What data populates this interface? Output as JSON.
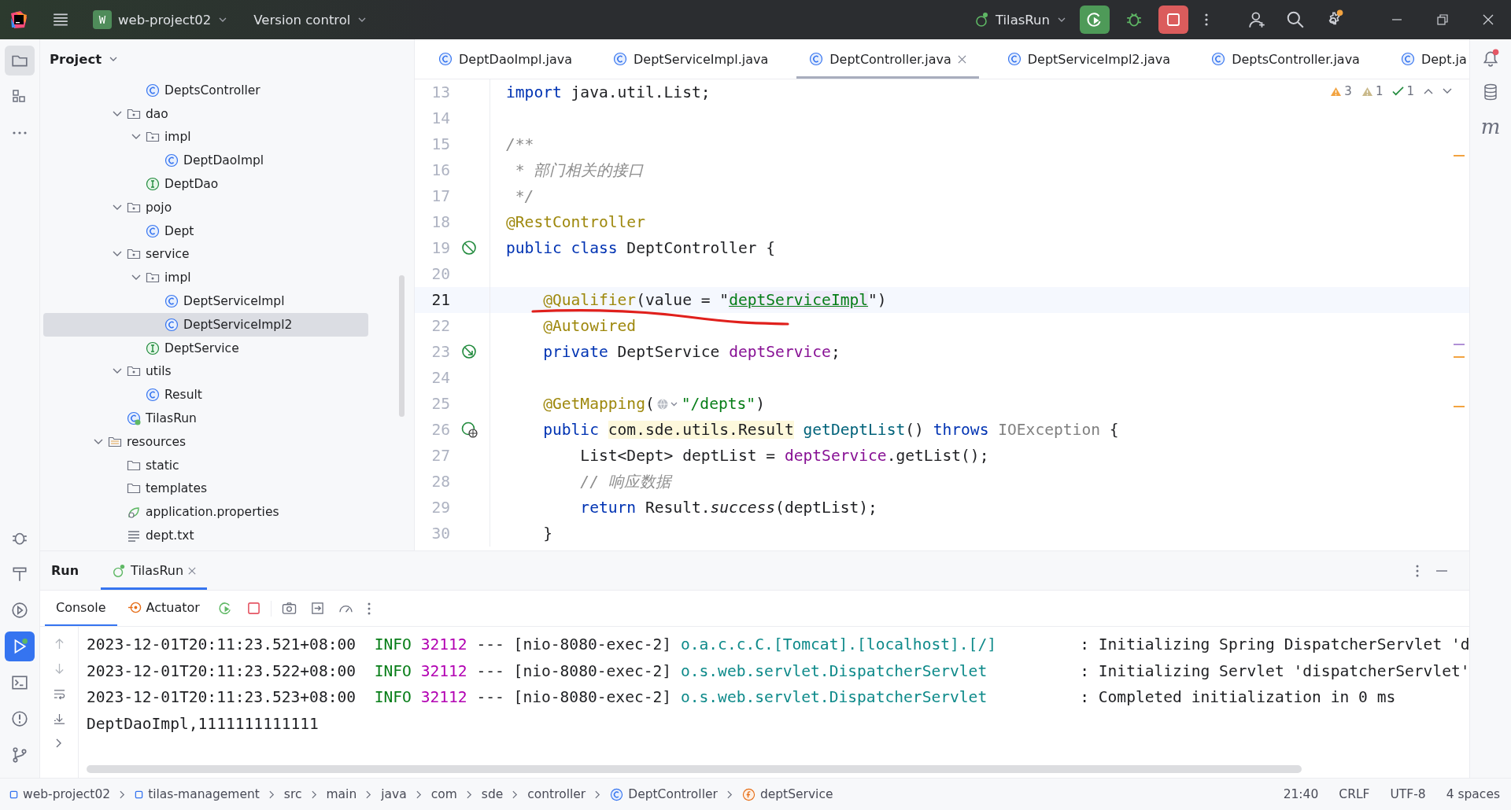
{
  "title_bar": {
    "project_badge": "W",
    "project": "web-project02",
    "vcs": "Version control",
    "run_config": "TilasRun"
  },
  "left_toolbar": {
    "top": [
      {
        "kind": "folder",
        "selected": true
      },
      {
        "kind": "structure",
        "selected": false
      },
      {
        "kind": "more",
        "selected": false
      }
    ],
    "bottom": [
      {
        "kind": "debug",
        "selected": false
      },
      {
        "kind": "build",
        "selected": false
      },
      {
        "kind": "services",
        "selected": false
      },
      {
        "kind": "run",
        "selected": true
      },
      {
        "kind": "terminal",
        "selected": false
      },
      {
        "kind": "problems",
        "selected": false
      },
      {
        "kind": "git",
        "selected": false
      }
    ]
  },
  "right_toolbar": {
    "maven_label": "m"
  },
  "project": {
    "title": "Project",
    "tree": [
      {
        "kind": "cut",
        "children": [
          {
            "kind": "cut",
            "children": [
              {
                "label": "DeptsController",
                "kind": "class",
                "selected": false
              }
            ]
          },
          {
            "label": "dao",
            "kind": "package",
            "expanded": true,
            "selected": false,
            "children": [
              {
                "label": "impl",
                "kind": "package",
                "expanded": true,
                "selected": false,
                "children": [
                  {
                    "label": "DeptDaoImpl",
                    "kind": "class",
                    "selected": false
                  }
                ]
              },
              {
                "label": "DeptDao",
                "kind": "interface",
                "selected": false
              }
            ]
          },
          {
            "label": "pojo",
            "kind": "package",
            "expanded": true,
            "selected": false,
            "children": [
              {
                "label": "Dept",
                "kind": "class",
                "selected": false
              }
            ]
          },
          {
            "label": "service",
            "kind": "package",
            "expanded": true,
            "selected": false,
            "children": [
              {
                "label": "impl",
                "kind": "package",
                "expanded": true,
                "selected": false,
                "children": [
                  {
                    "label": "DeptServiceImpl",
                    "kind": "class",
                    "selected": false
                  },
                  {
                    "label": "DeptServiceImpl2",
                    "kind": "class",
                    "selected": true
                  }
                ]
              },
              {
                "label": "DeptService",
                "kind": "interface",
                "selected": false
              }
            ]
          },
          {
            "label": "utils",
            "kind": "package",
            "expanded": true,
            "selected": false,
            "children": [
              {
                "label": "Result",
                "kind": "class",
                "selected": false
              }
            ]
          },
          {
            "label": "TilasRun",
            "kind": "app",
            "selected": false
          }
        ]
      },
      {
        "label": "resources",
        "kind": "resources",
        "expanded": true,
        "selected": false,
        "children": [
          {
            "label": "static",
            "kind": "folder",
            "selected": false
          },
          {
            "label": "templates",
            "kind": "folder",
            "selected": false
          },
          {
            "label": "application.properties",
            "kind": "properties",
            "selected": false
          },
          {
            "label": "dept.txt",
            "kind": "text",
            "selected": false
          }
        ]
      }
    ]
  },
  "editor": {
    "tabs": [
      {
        "label": "DeptDaoImpl.java",
        "selected": false
      },
      {
        "label": "DeptServiceImpl.java",
        "selected": false
      },
      {
        "label": "DeptController.java",
        "selected": true
      },
      {
        "label": "DeptServiceImpl2.java",
        "selected": false
      },
      {
        "label": "DeptsController.java",
        "selected": false
      },
      {
        "label": "Dept.ja",
        "selected": false
      }
    ],
    "inspections": {
      "warnings": "3",
      "weak_warnings": "1",
      "passed": "1"
    },
    "lines": [
      {
        "n": "13",
        "current": false,
        "tokens": [
          {
            "kind": "keyword",
            "text": "import "
          },
          {
            "kind": "plain",
            "text": "java.util.List;"
          }
        ]
      },
      {
        "n": "14",
        "current": false
      },
      {
        "n": "15",
        "current": false,
        "tokens": [
          {
            "kind": "comment",
            "text": "/**"
          }
        ]
      },
      {
        "n": "16",
        "current": false,
        "tokens": [
          {
            "kind": "comment",
            "text": " * 部门相关的接口"
          }
        ]
      },
      {
        "n": "17",
        "current": false,
        "tokens": [
          {
            "kind": "comment",
            "text": " */"
          }
        ]
      },
      {
        "n": "18",
        "current": false,
        "tokens": [
          {
            "kind": "annotation",
            "text": "@RestController"
          }
        ]
      },
      {
        "n": "19",
        "current": false,
        "gutter_icon": {
          "kind": "bean"
        },
        "tokens": [
          {
            "kind": "keyword",
            "text": "public class "
          },
          {
            "kind": "plain",
            "text": "DeptController {"
          }
        ]
      },
      {
        "n": "20",
        "current": false
      },
      {
        "n": "21",
        "current": true,
        "tokens": [
          {
            "kind": "annotation",
            "text": "    @Qualifier"
          },
          {
            "kind": "plain",
            "text": "(value = \""
          },
          {
            "kind": "reference",
            "text": "deptServiceImpl"
          },
          {
            "kind": "plain",
            "text": "\")"
          }
        ]
      },
      {
        "n": "22",
        "current": false,
        "tokens": [
          {
            "kind": "annotation",
            "text": "    @Autowired"
          }
        ]
      },
      {
        "n": "23",
        "current": false,
        "gutter_icon": {
          "kind": "inject"
        },
        "tokens": [
          {
            "kind": "keyword",
            "text": "    private "
          },
          {
            "kind": "plain",
            "text": "DeptService "
          },
          {
            "kind": "field",
            "text": "deptService"
          },
          {
            "kind": "plain",
            "text": ";"
          }
        ]
      },
      {
        "n": "24",
        "current": false
      },
      {
        "n": "25",
        "current": false,
        "tokens": [
          {
            "kind": "annotation",
            "text": "    @GetMapping"
          },
          {
            "kind": "plain",
            "text": "("
          },
          {
            "kind": "inlay"
          },
          {
            "kind": "string",
            "text": "\"/depts\""
          },
          {
            "kind": "plain",
            "text": ")"
          }
        ]
      },
      {
        "n": "26",
        "current": false,
        "gutter_icon": {
          "kind": "web"
        },
        "tokens": [
          {
            "kind": "keyword",
            "text": "    public "
          },
          {
            "kind": "highlight",
            "text": "com.sde.utils.Result"
          },
          {
            "kind": "method",
            "text": " getDeptList"
          },
          {
            "kind": "plain",
            "text": "() "
          },
          {
            "kind": "keyword",
            "text": "throws "
          },
          {
            "kind": "unused",
            "text": "IOException"
          },
          {
            "kind": "plain",
            "text": " {"
          }
        ]
      },
      {
        "n": "27",
        "current": false,
        "tokens": [
          {
            "kind": "plain",
            "text": "        List<Dept> deptList = "
          },
          {
            "kind": "field",
            "text": "deptService"
          },
          {
            "kind": "plain",
            "text": ".getList();"
          }
        ]
      },
      {
        "n": "28",
        "current": false,
        "tokens": [
          {
            "kind": "comment",
            "text": "        // 响应数据"
          }
        ]
      },
      {
        "n": "29",
        "current": false,
        "tokens": [
          {
            "kind": "keyword",
            "text": "        return "
          },
          {
            "kind": "plain",
            "text": "Result."
          },
          {
            "kind": "italic",
            "text": "success"
          },
          {
            "kind": "plain",
            "text": "(deptList);"
          }
        ]
      },
      {
        "n": "30",
        "current": false,
        "tokens": [
          {
            "kind": "plain",
            "text": "    }"
          }
        ]
      }
    ]
  },
  "run_panel": {
    "title": "Run",
    "tabs": [
      {
        "label": "TilasRun",
        "selected": true
      }
    ],
    "subtabs": [
      {
        "label": "Console",
        "kind": "console",
        "selected": true
      },
      {
        "label": "Actuator",
        "kind": "actuator",
        "selected": false
      }
    ],
    "lines": [
      {
        "kind": "log",
        "time": "2023-12-01T20:11:23.521+08:00",
        "level": "INFO",
        "pid": "32112",
        "sep": "---",
        "thread": "[nio-8080-exec-2]",
        "logger": "o.a.c.c.C.[Tomcat].[localhost].[/]",
        "message": ": Initializing Spring DispatcherServlet 'd"
      },
      {
        "kind": "log",
        "time": "2023-12-01T20:11:23.522+08:00",
        "level": "INFO",
        "pid": "32112",
        "sep": "---",
        "thread": "[nio-8080-exec-2]",
        "logger": "o.s.web.servlet.DispatcherServlet",
        "message": ": Initializing Servlet 'dispatcherServlet'"
      },
      {
        "kind": "log",
        "time": "2023-12-01T20:11:23.523+08:00",
        "level": "INFO",
        "pid": "32112",
        "sep": "---",
        "thread": "[nio-8080-exec-2]",
        "logger": "o.s.web.servlet.DispatcherServlet",
        "message": ": Completed initialization in 0 ms"
      },
      {
        "kind": "plain",
        "text": "DeptDaoImpl,1111111111111"
      }
    ]
  },
  "status_bar": {
    "breadcrumbs": [
      {
        "label": "web-project02",
        "kind": "module"
      },
      {
        "label": "tilas-management",
        "kind": "module"
      },
      {
        "label": "src",
        "kind": "plain"
      },
      {
        "label": "main",
        "kind": "plain"
      },
      {
        "label": "java",
        "kind": "plain"
      },
      {
        "label": "com",
        "kind": "plain"
      },
      {
        "label": "sde",
        "kind": "plain"
      },
      {
        "label": "controller",
        "kind": "plain"
      },
      {
        "label": "DeptController",
        "kind": "class"
      },
      {
        "label": "deptService",
        "kind": "field"
      }
    ],
    "items": [
      "21:40",
      "CRLF",
      "UTF-8",
      "4 spaces"
    ]
  }
}
